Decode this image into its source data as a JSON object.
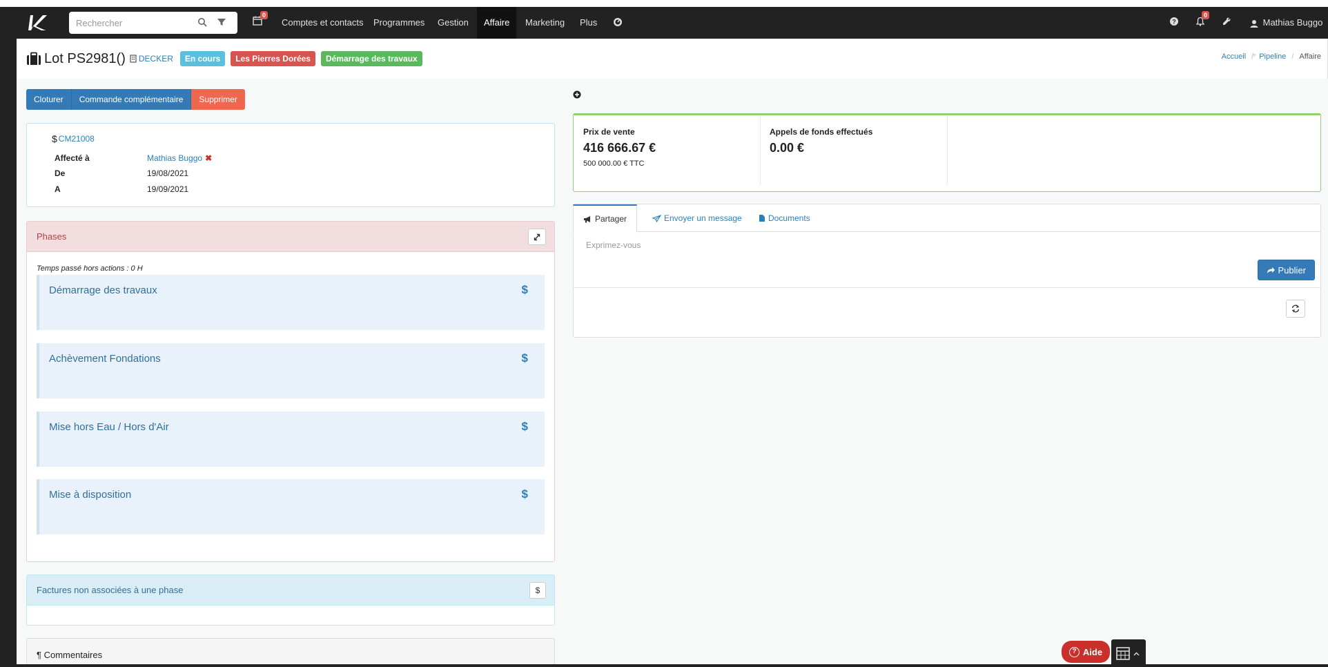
{
  "navbar": {
    "search_placeholder": "Rechercher",
    "calendar_badge": "0",
    "items": [
      "Comptes et contacts",
      "Programmes",
      "Gestion",
      "Affaire",
      "Marketing",
      "Plus"
    ],
    "active_item": "Affaire",
    "notifications_badge": "0",
    "user_name": "Mathias Buggo"
  },
  "header": {
    "title": "Lot PS2981()",
    "company": "DECKER",
    "labels": [
      {
        "text": "En cours",
        "color": "#5bc0de"
      },
      {
        "text": "Les Pierres Dorées",
        "color": "#d9534f"
      },
      {
        "text": "Démarrage des travaux",
        "color": "#5cb85c"
      }
    ]
  },
  "breadcrumb": [
    "Accueil",
    "Pipeline",
    "Affaire"
  ],
  "actions": {
    "cloturer": "Cloturer",
    "commande": "Commande complémentaire",
    "supprimer": "Supprimer"
  },
  "info": {
    "reference": "CM21008",
    "rows": [
      {
        "key": "Affecté à",
        "value": "Mathias Buggo"
      },
      {
        "key": "De",
        "value": "19/08/2021"
      },
      {
        "key": "A",
        "value": "19/09/2021"
      }
    ]
  },
  "phases": {
    "title": "Phases",
    "temps": "Temps passé hors actions : 0 H",
    "items": [
      "Démarrage des travaux",
      "Achèvement Fondations",
      "Mise hors Eau / Hors d'Air",
      "Mise à disposition"
    ]
  },
  "factures": {
    "title": "Factures non associées à une phase",
    "button": "$"
  },
  "commentaires": {
    "title": "¶ Commentaires"
  },
  "stats": {
    "prix_label": "Prix de vente",
    "prix_value": "416 666.67 €",
    "prix_ttc": "500 000.00 € TTC",
    "appels_label": "Appels de fonds effectués",
    "appels_value": "0.00 €"
  },
  "share": {
    "tabs": [
      "Partager",
      "Envoyer un message",
      "Documents"
    ],
    "placeholder": "Exprimez-vous",
    "publish": "Publier"
  },
  "widgets": {
    "aide": "Aide"
  },
  "colors": {
    "navbar": "#222222",
    "primary": "#337ab7",
    "danger": "#f0674f",
    "success_border": "#8fd16d"
  }
}
